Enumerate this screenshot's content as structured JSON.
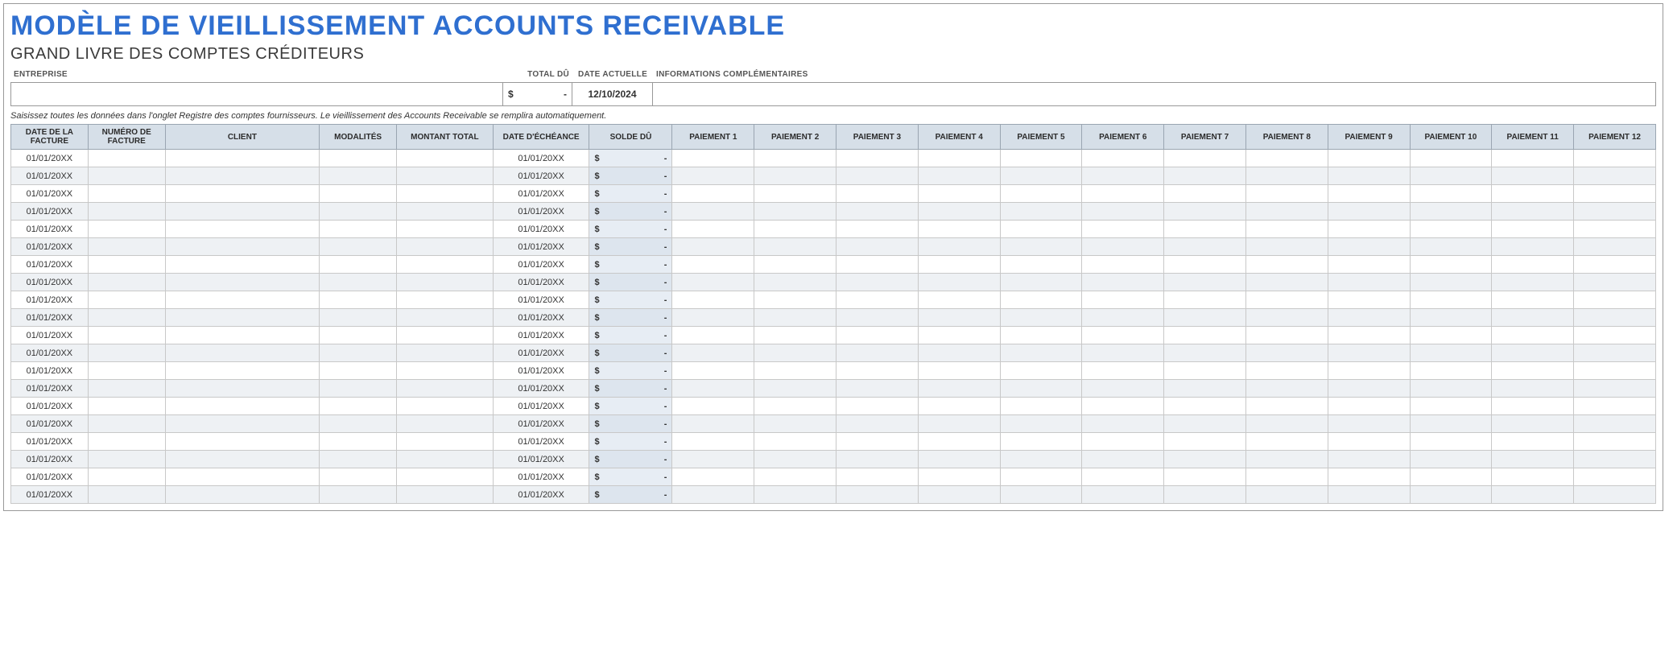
{
  "title": "MODÈLE DE VIEILLISSEMENT ACCOUNTS RECEIVABLE",
  "subtitle": "GRAND LIVRE DES COMPTES CRÉDITEURS",
  "labels": {
    "entreprise": "ENTREPRISE",
    "total_du": "TOTAL DÛ",
    "date_actuelle": "DATE ACTUELLE",
    "informations": "INFORMATIONS COMPLÉMENTAIRES"
  },
  "header_values": {
    "entreprise": "",
    "total_currency": "$",
    "total_value": "-",
    "date_actuelle": "12/10/2024",
    "informations": ""
  },
  "instructions": "Saisissez toutes les données dans l'onglet Registre des comptes fournisseurs.  Le vieillissement des Accounts Receivable se remplira automatiquement.",
  "columns": {
    "date_facture": "DATE DE LA FACTURE",
    "numero_facture": "NUMÉRO DE FACTURE",
    "client": "CLIENT",
    "modalites": "MODALITÉS",
    "montant_total": "MONTANT TOTAL",
    "date_echeance": "DATE D'ÉCHÉANCE",
    "solde_du": "SOLDE DÛ",
    "paiement1": "PAIEMENT 1",
    "paiement2": "PAIEMENT 2",
    "paiement3": "PAIEMENT 3",
    "paiement4": "PAIEMENT 4",
    "paiement5": "PAIEMENT 5",
    "paiement6": "PAIEMENT 6",
    "paiement7": "PAIEMENT 7",
    "paiement8": "PAIEMENT 8",
    "paiement9": "PAIEMENT 9",
    "paiement10": "PAIEMENT 10",
    "paiement11": "PAIEMENT 11",
    "paiement12": "PAIEMENT 12"
  },
  "row_defaults": {
    "date_facture": "01/01/20XX",
    "date_echeance": "01/01/20XX",
    "solde_currency": "$",
    "solde_value": "-"
  },
  "row_count": 20
}
